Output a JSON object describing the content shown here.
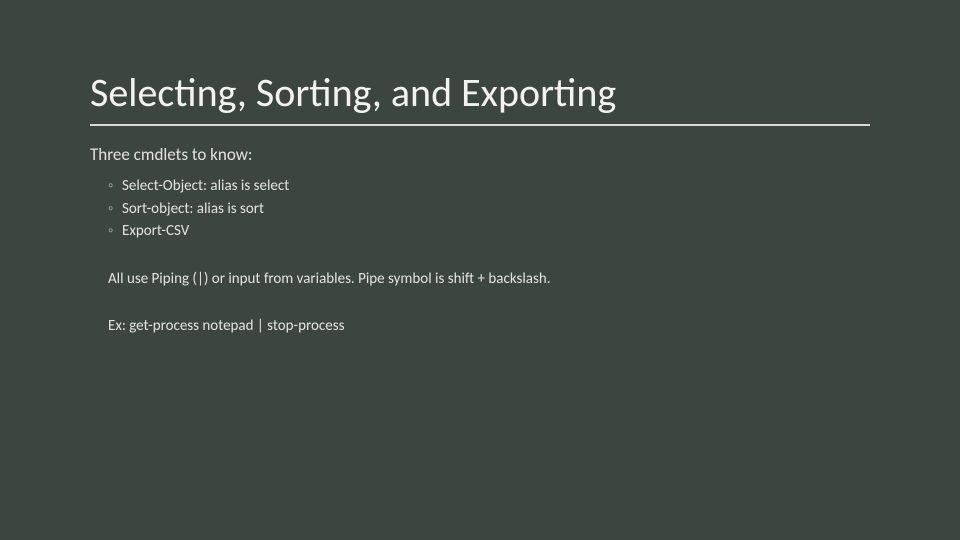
{
  "slide": {
    "title": "Selecting, Sorting, and Exporting",
    "intro": "Three cmdlets to know:",
    "bullets": [
      "Select-Object: alias is select",
      "Sort-object: alias is sort",
      "Export-CSV"
    ],
    "piping_note": "All use Piping (|) or input from variables. Pipe symbol is shift + backslash.",
    "example": "Ex:  get-process notepad | stop-process",
    "bullet_mark": "◦"
  },
  "colors": {
    "background": "#3d4540",
    "text": "#e8e8e8",
    "rule": "#d9d9d9"
  }
}
